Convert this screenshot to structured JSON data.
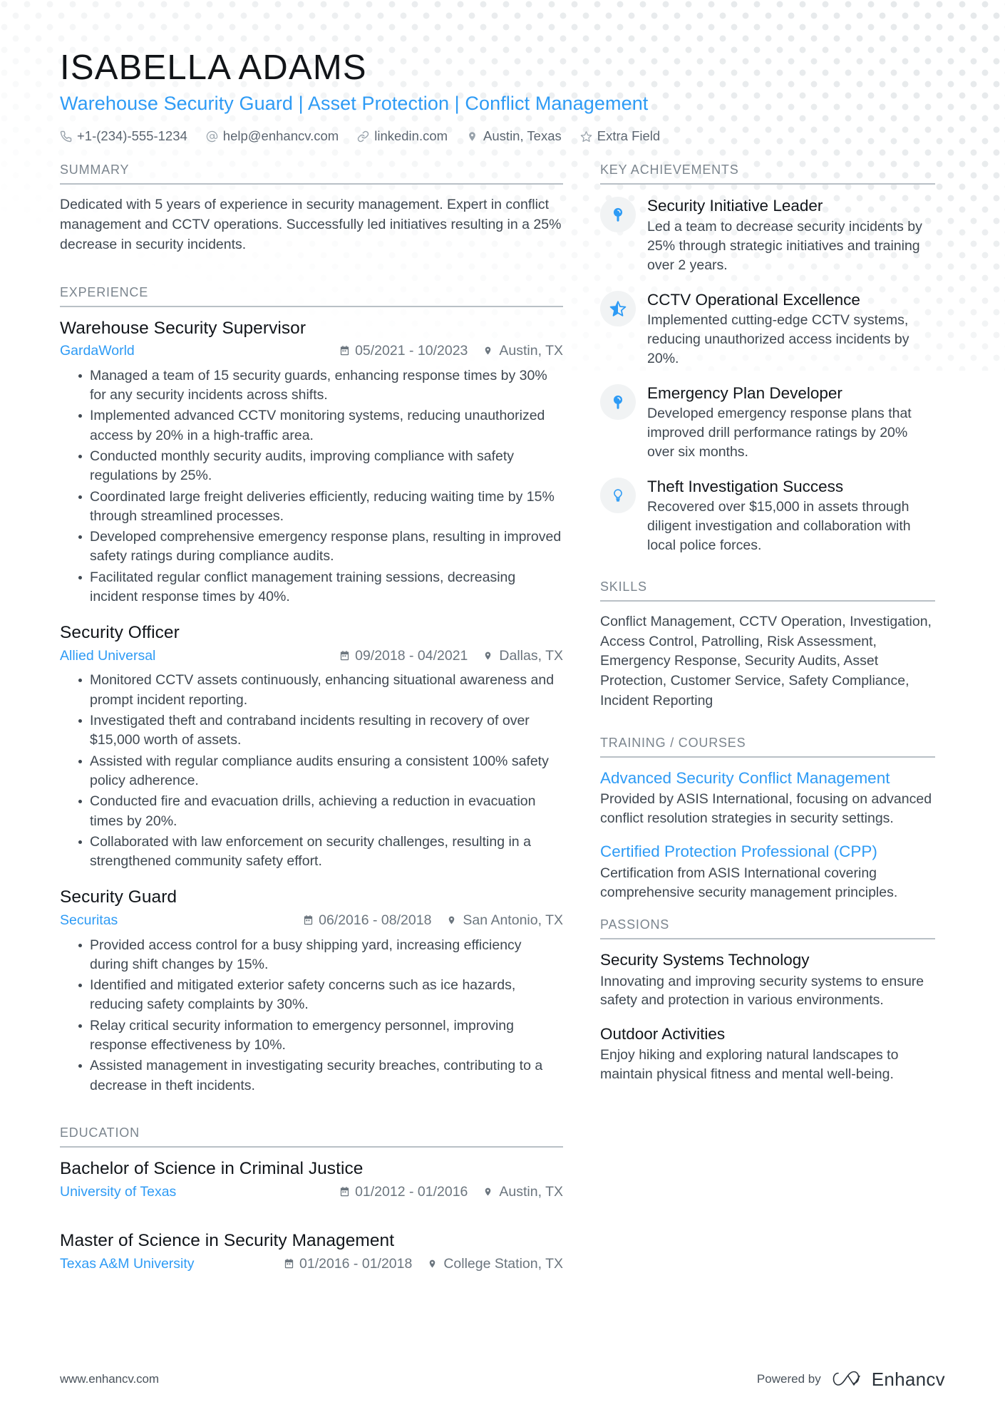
{
  "colors": {
    "accent": "#2e9bf5",
    "heading": "#11151a",
    "body_text": "#3f4851",
    "section_label": "#7b858e",
    "rule": "#b9c0c6",
    "badge_bg": "#f1f3f4",
    "dot_pattern": "#e6e9eb"
  },
  "header": {
    "name": "ISABELLA ADAMS",
    "headline": "Warehouse Security Guard | Asset Protection | Conflict Management",
    "contacts": [
      {
        "icon": "phone-icon",
        "text": "+1-(234)-555-1234"
      },
      {
        "icon": "email-icon",
        "text": "help@enhancv.com"
      },
      {
        "icon": "link-icon",
        "text": "linkedin.com"
      },
      {
        "icon": "location-pin-icon",
        "text": "Austin, Texas"
      },
      {
        "icon": "star-icon",
        "text": "Extra Field"
      }
    ]
  },
  "left_column": {
    "summary": {
      "section_title": "SUMMARY",
      "text": "Dedicated with 5 years of experience in security management. Expert in conflict management and CCTV operations. Successfully led initiatives resulting in a 25% decrease in security incidents."
    },
    "experience": {
      "section_title": "EXPERIENCE",
      "entries": [
        {
          "title": "Warehouse Security Supervisor",
          "organization": "GardaWorld",
          "dates": "05/2021 - 10/2023",
          "location": "Austin, TX",
          "bullets": [
            "Managed a team of 15 security guards, enhancing response times by 30% for any security incidents across shifts.",
            "Implemented advanced CCTV monitoring systems, reducing unauthorized access by 20% in a high-traffic area.",
            "Conducted monthly security audits, improving compliance with safety regulations by 25%.",
            "Coordinated large freight deliveries efficiently, reducing waiting time by 15% through streamlined processes.",
            "Developed comprehensive emergency response plans, resulting in improved safety ratings during compliance audits.",
            "Facilitated regular conflict management training sessions, decreasing incident response times by 40%."
          ]
        },
        {
          "title": "Security Officer",
          "organization": "Allied Universal",
          "dates": "09/2018 - 04/2021",
          "location": "Dallas, TX",
          "bullets": [
            "Monitored CCTV assets continuously, enhancing situational awareness and prompt incident reporting.",
            "Investigated theft and contraband incidents resulting in recovery of over $15,000 worth of assets.",
            "Assisted with regular compliance audits ensuring a consistent 100% safety policy adherence.",
            "Conducted fire and evacuation drills, achieving a reduction in evacuation times by 20%.",
            "Collaborated with law enforcement on security challenges, resulting in a strengthened community safety effort."
          ]
        },
        {
          "title": "Security Guard",
          "organization": "Securitas",
          "dates": "06/2016 - 08/2018",
          "location": "San Antonio, TX",
          "bullets": [
            "Provided access control for a busy shipping yard, increasing efficiency during shift changes by 15%.",
            "Identified and mitigated exterior safety concerns such as ice hazards, reducing safety complaints by 30%.",
            "Relay critical security information to emergency personnel, improving response effectiveness by 10%.",
            "Assisted management in investigating security breaches, contributing to a decrease in theft incidents."
          ]
        }
      ]
    },
    "education": {
      "section_title": "EDUCATION",
      "entries": [
        {
          "title": "Bachelor of Science in Criminal Justice",
          "organization": "University of Texas",
          "dates": "01/2012 - 01/2016",
          "location": "Austin, TX"
        },
        {
          "title": "Master of Science in Security Management",
          "organization": "Texas A&M University",
          "dates": "01/2016 - 01/2018",
          "location": "College Station, TX"
        }
      ]
    }
  },
  "right_column": {
    "key_achievements": {
      "section_title": "KEY ACHIEVEMENTS",
      "items": [
        {
          "icon": "pin-badge-icon",
          "title": "Security Initiative Leader",
          "description": "Led a team to decrease security incidents by 25% through strategic initiatives and training over 2 years."
        },
        {
          "icon": "star-badge-icon",
          "title": "CCTV Operational Excellence",
          "description": "Implemented cutting-edge CCTV systems, reducing unauthorized access incidents by 20%."
        },
        {
          "icon": "pin-badge-icon",
          "title": "Emergency Plan Developer",
          "description": "Developed emergency response plans that improved drill performance ratings by 20% over six months."
        },
        {
          "icon": "lightbulb-badge-icon",
          "title": "Theft Investigation Success",
          "description": "Recovered over $15,000 in assets through diligent investigation and collaboration with local police forces."
        }
      ]
    },
    "skills": {
      "section_title": "SKILLS",
      "text": "Conflict Management, CCTV Operation, Investigation, Access Control, Patrolling, Risk Assessment, Emergency Response, Security Audits, Asset Protection, Customer Service, Safety Compliance, Incident Reporting"
    },
    "training": {
      "section_title": "TRAINING / COURSES",
      "entries": [
        {
          "title": "Advanced Security Conflict Management",
          "description": "Provided by ASIS International, focusing on advanced conflict resolution strategies in security settings."
        },
        {
          "title": "Certified Protection Professional (CPP)",
          "description": "Certification from ASIS International covering comprehensive security management principles."
        }
      ]
    },
    "passions": {
      "section_title": "PASSIONS",
      "entries": [
        {
          "title": "Security Systems Technology",
          "description": "Innovating and improving security systems to ensure safety and protection in various environments."
        },
        {
          "title": "Outdoor Activities",
          "description": "Enjoy hiking and exploring natural landscapes to maintain physical fitness and mental well-being."
        }
      ]
    }
  },
  "footer": {
    "url": "www.enhancv.com",
    "powered_by": "Powered by",
    "brand": "Enhancv"
  }
}
